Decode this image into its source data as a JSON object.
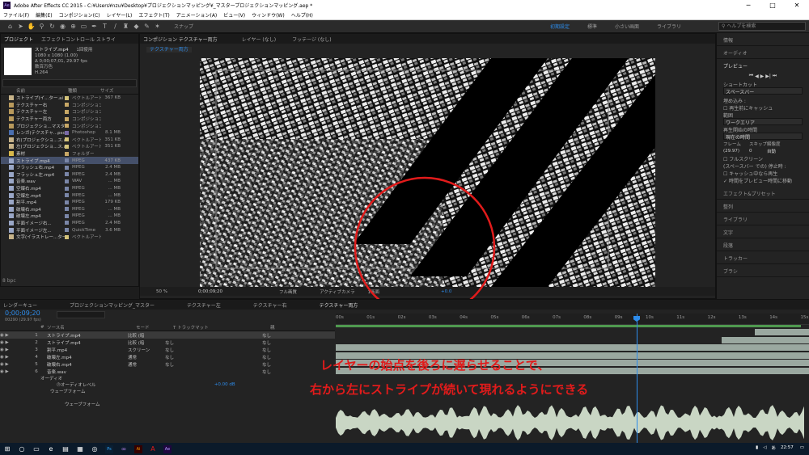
{
  "window": {
    "title": "Adobe After Effects CC 2015 - C:¥Users¥nzu¥Desktop¥プロジェクションマッピング¥_マスタープロジェクションマッピング.aep *",
    "min": "─",
    "max": "□",
    "close": "✕"
  },
  "menu": [
    "ファイル(F)",
    "編集(E)",
    "コンポジション(C)",
    "レイヤー(L)",
    "エフェクト(T)",
    "アニメーション(A)",
    "ビュー(V)",
    "ウィンドウ(W)",
    "ヘルプ(H)"
  ],
  "toolbar": {
    "snap": "スナップ",
    "workspaces": [
      "初期設定",
      "標準",
      "小さい画面",
      "ライブラリ"
    ],
    "active_ws": "初期設定",
    "search_placeholder": "ヘルプを検索"
  },
  "project": {
    "tabs": [
      "プロジェクト",
      "エフェクトコントロール ストライ"
    ],
    "selected_item": "ストライプ.mp4",
    "used": "1回使用",
    "info": [
      "1080 x 1080 (1.00)",
      "Δ 0;00;07;01, 29.97 fps",
      "数百万色",
      "H.264"
    ],
    "columns": [
      "名前",
      "種類",
      "サイズ"
    ],
    "rows": [
      {
        "name": "ストライプ(イ...ター.ai",
        "type": "ベクトルアート",
        "size": "367 KB",
        "c": "#c8b48a",
        "lc": "#d4c37a"
      },
      {
        "name": "テクスチャー右",
        "type": "コンポジション",
        "size": "",
        "c": "#b99a5c",
        "lc": "#c8a866"
      },
      {
        "name": "テクスチャー左",
        "type": "コンポジション",
        "size": "",
        "c": "#b99a5c",
        "lc": "#c8a866"
      },
      {
        "name": "テクスチャー両方",
        "type": "コンポジション",
        "size": "",
        "c": "#b99a5c",
        "lc": "#c8a866"
      },
      {
        "name": "プロジェクショ...マスター",
        "type": "コンポジション",
        "size": "",
        "c": "#b99a5c",
        "lc": "#c8a866"
      },
      {
        "name": "レンガ(テクスチャ...psd",
        "type": "Photoshop",
        "size": "8.1 MB",
        "c": "#4a6fb0",
        "lc": "#7a6aa8"
      },
      {
        "name": "右(プロジェクショ...ス.ai",
        "type": "ベクトルアート",
        "size": "351 KB",
        "c": "#c8b48a",
        "lc": "#d4c37a"
      },
      {
        "name": "左(プロジェクショ...ス.ai",
        "type": "ベクトルアート",
        "size": "351 KB",
        "c": "#c8b48a",
        "lc": "#d4c37a"
      },
      {
        "name": "素材",
        "type": "フォルダー",
        "size": "",
        "c": "#d8b84a",
        "lc": "#c8a866"
      },
      {
        "name": "ストライプ.mp4",
        "type": "MPEG",
        "size": "437 KB",
        "c": "#9aa7c7",
        "lc": "#7a86a8",
        "sel": true
      },
      {
        "name": "フラッシュ右.mp4",
        "type": "MPEG",
        "size": "2.4 MB",
        "c": "#9aa7c7",
        "lc": "#7a86a8"
      },
      {
        "name": "フラッシュ左.mp4",
        "type": "MPEG",
        "size": "2.4 MB",
        "c": "#9aa7c7",
        "lc": "#7a86a8"
      },
      {
        "name": "音楽.wav",
        "type": "WAV",
        "size": "... MB",
        "c": "#9aa7c7",
        "lc": "#7a86a8"
      },
      {
        "name": "空爆右.mp4",
        "type": "MPEG",
        "size": "... MB",
        "c": "#9aa7c7",
        "lc": "#7a86a8"
      },
      {
        "name": "空爆左.mp4",
        "type": "MPEG",
        "size": "... MB",
        "c": "#9aa7c7",
        "lc": "#7a86a8"
      },
      {
        "name": "割平.mp4",
        "type": "MPEG",
        "size": "179 KB",
        "c": "#9aa7c7",
        "lc": "#7a86a8"
      },
      {
        "name": "破壊右.mp4",
        "type": "MPEG",
        "size": "... MB",
        "c": "#9aa7c7",
        "lc": "#7a86a8"
      },
      {
        "name": "破壊左.mp4",
        "type": "MPEG",
        "size": "... MB",
        "c": "#9aa7c7",
        "lc": "#7a86a8"
      },
      {
        "name": "平面イメージ右...",
        "type": "MPEG",
        "size": "2.4 MB",
        "c": "#9aa7c7",
        "lc": "#7a86a8"
      },
      {
        "name": "平面イメージ左...",
        "type": "QuickTime",
        "size": "3.6 MB",
        "c": "#9aa7c7",
        "lc": "#7a86a8"
      },
      {
        "name": "文字(イラストレー...ター.ai",
        "type": "ベクトルアート",
        "size": "",
        "c": "#c8b48a",
        "lc": "#d4c37a"
      }
    ],
    "bpc": "8 bpc"
  },
  "comp": {
    "tabs": [
      "コンポジション テクスチャー両方",
      "レイヤー (なし)",
      "フッテージ (なし)"
    ],
    "active_tab": "コンポジション テクスチャー両方",
    "sub_tab": "テクスチャー両方",
    "footer": {
      "zoom": "50 %",
      "timecode": "0;00;09;20",
      "quality": "フル画質",
      "camera": "アクティブカメラ",
      "views": "1画面",
      "exposure": "+0.0"
    }
  },
  "right": {
    "sections": [
      "情報",
      "オーディオ",
      "プレビュー"
    ],
    "shortcut_label": "ショートカット",
    "shortcut_value": "スペースバー",
    "include_label": "埋め込み :",
    "cache_label": "再生前にキャッシュ",
    "range_label": "範囲",
    "range_value": "ワークエリア",
    "play_from_label": "再生開始の時間",
    "play_from_value": "現在の時間",
    "frame_label": "フレーム",
    "skip_label": "スキップ",
    "res_label": "解像度",
    "frame_value": "(29.97)",
    "skip_value": "0",
    "res_value": "自動",
    "fullscreen": "フルスクリーン",
    "stop_label": "(スペースバー での) 停止時 :",
    "stop_cache": "キャッシュ中なら再生",
    "stop_move": "時間をプレビュー時間に移動",
    "panels": [
      "エフェクト&プリセット",
      "整列",
      "ライブラリ",
      "文字",
      "段落",
      "トラッカー",
      "ブラシ"
    ]
  },
  "timeline": {
    "tabs": [
      "レンダーキュー",
      "プロジェクションマッピング_マスター",
      "テクスチャー左",
      "テクスチャー右",
      "テクスチャー両方"
    ],
    "active_tab": "テクスチャー両方",
    "timecode": "0;00;09;20",
    "frames": "00290 (29.97 fps)",
    "cols": {
      "num": "#",
      "source": "ソース名",
      "mode": "モード",
      "trk": "T トラックマット",
      "parent": "親"
    },
    "ruler": [
      "00s",
      "01s",
      "02s",
      "03s",
      "04s",
      "05s",
      "06s",
      "07s",
      "08s",
      "09s",
      "10s",
      "11s",
      "12s",
      "13s",
      "14s",
      "15s"
    ],
    "layers": [
      {
        "num": "1",
        "name": "ストライプ.mp4",
        "mode": "比較 (暗",
        "trk": "",
        "parent": "なし",
        "sel": true,
        "bar_start": 0.9,
        "bar_color": "#9aa8a0"
      },
      {
        "name": "ストライプ.mp4",
        "num": "2",
        "mode": "比較 (暗",
        "trk": "なし",
        "parent": "なし",
        "bar_start": 0.83,
        "bar_color": "#9aa8a0"
      },
      {
        "num": "3",
        "name": "割平.mp4",
        "mode": "スクリーン",
        "trk": "なし",
        "parent": "なし",
        "bar_start": 0.0,
        "bar_color": "#9aa8a0"
      },
      {
        "num": "4",
        "name": "破壊左.mp4",
        "mode": "通常",
        "trk": "なし",
        "parent": "なし",
        "bar_start": 0.0,
        "bar_color": "#9aa8a0"
      },
      {
        "num": "5",
        "name": "破壊右.mp4",
        "mode": "通常",
        "trk": "なし",
        "parent": "なし",
        "bar_start": 0.0,
        "bar_color": "#9aa8a0"
      },
      {
        "num": "6",
        "name": "音楽.wav",
        "mode": "",
        "trk": "",
        "parent": "なし",
        "bar_start": 0.0,
        "bar_color": "#9aa8a0"
      }
    ],
    "audio_label": "オーディオ",
    "audio_level": "オーディオレベル",
    "audio_val": "+0.00 dB",
    "waveform": "ウェーブフォーム",
    "waveform2": "ウェーブフォーム"
  },
  "annotation": {
    "line1": "レイヤーの始点を後ろに遅らせることで、",
    "line2": "右から左にストライプが続いて現れるようにできる",
    "color": "#e11b1b"
  },
  "taskbar": {
    "time": "22:57"
  }
}
